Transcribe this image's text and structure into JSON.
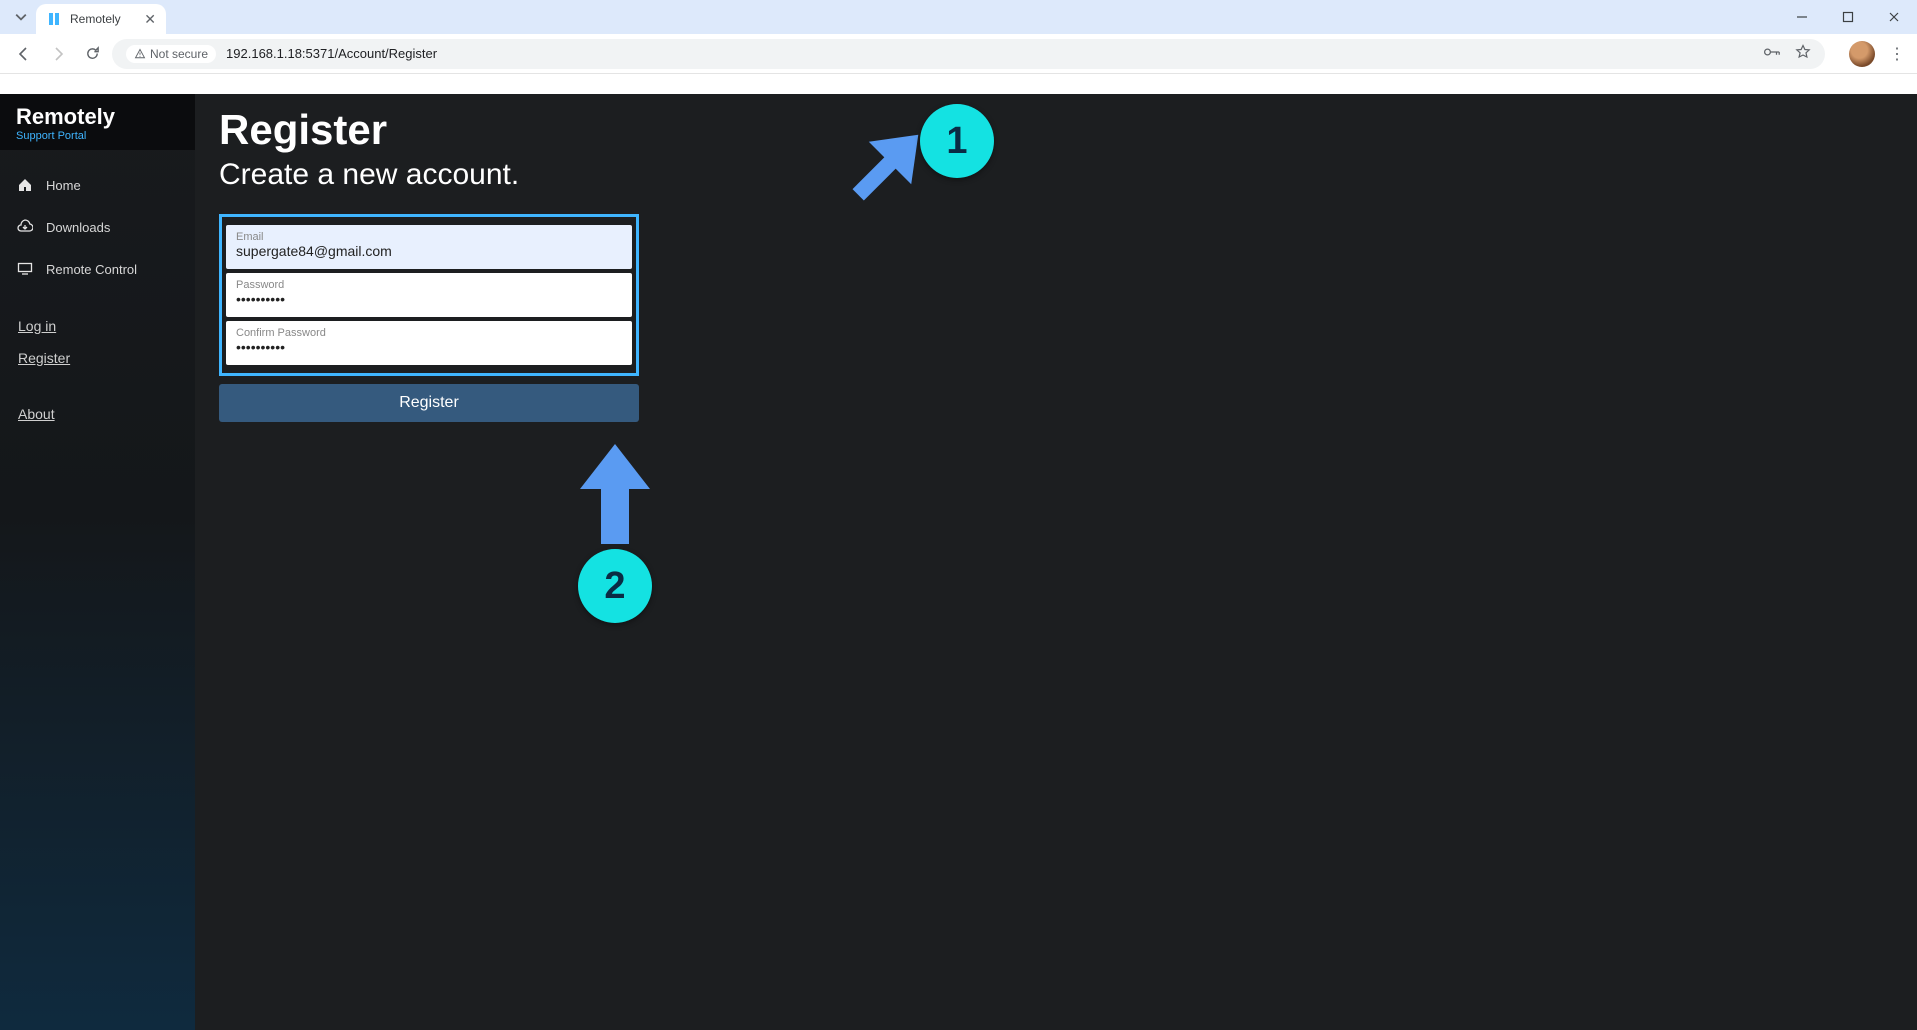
{
  "browser": {
    "tab_title": "Remotely",
    "not_secure_label": "Not secure",
    "url": "192.168.1.18:5371/Account/Register"
  },
  "sidebar": {
    "brand": "Remotely",
    "subtitle": "Support Portal",
    "items": [
      {
        "label": "Home"
      },
      {
        "label": "Downloads"
      },
      {
        "label": "Remote Control"
      }
    ],
    "login_label": "Log in",
    "register_label": "Register",
    "about_label": "About"
  },
  "page": {
    "title": "Register",
    "subtitle": "Create a new account."
  },
  "form": {
    "email_label": "Email",
    "email_value": "supergate84@gmail.com",
    "password_label": "Password",
    "password_value": "••••••••••",
    "confirm_label": "Confirm Password",
    "confirm_value": "••••••••••",
    "submit_label": "Register"
  },
  "annotations": {
    "step1": "1",
    "step2": "2"
  },
  "colors": {
    "accent": "#3fb5ff",
    "callout": "#14e2e2",
    "arrow": "#5a9bf2",
    "btn": "#355a7e"
  }
}
